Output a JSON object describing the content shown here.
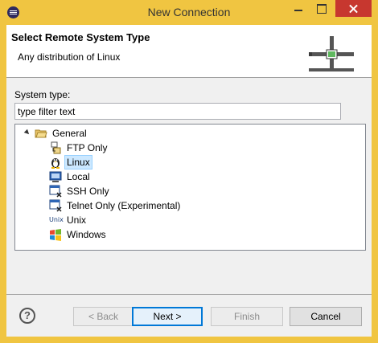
{
  "window": {
    "title": "New Connection"
  },
  "header": {
    "title": "Select Remote System Type",
    "description": "Any distribution of Linux"
  },
  "filter": {
    "label": "System type:",
    "value": "type filter text"
  },
  "tree": {
    "group": "General",
    "items": [
      {
        "label": "FTP Only",
        "icon": "ftp-icon"
      },
      {
        "label": "Linux",
        "icon": "linux-tux-icon",
        "selected": true
      },
      {
        "label": "Local",
        "icon": "local-computer-icon"
      },
      {
        "label": "SSH Only",
        "icon": "ssh-terminal-icon"
      },
      {
        "label": "Telnet Only (Experimental)",
        "icon": "telnet-terminal-icon"
      },
      {
        "label": "Unix",
        "icon": "unix-icon",
        "icon_text": "Unix"
      },
      {
        "label": "Windows",
        "icon": "windows-logo-icon"
      }
    ]
  },
  "buttons": {
    "help": "?",
    "back": "< Back",
    "next": "Next >",
    "finish": "Finish",
    "cancel": "Cancel"
  },
  "colors": {
    "frame": "#f0c541",
    "close": "#c7372f",
    "selection": "#cce8ff",
    "default_button_border": "#0078d7"
  }
}
